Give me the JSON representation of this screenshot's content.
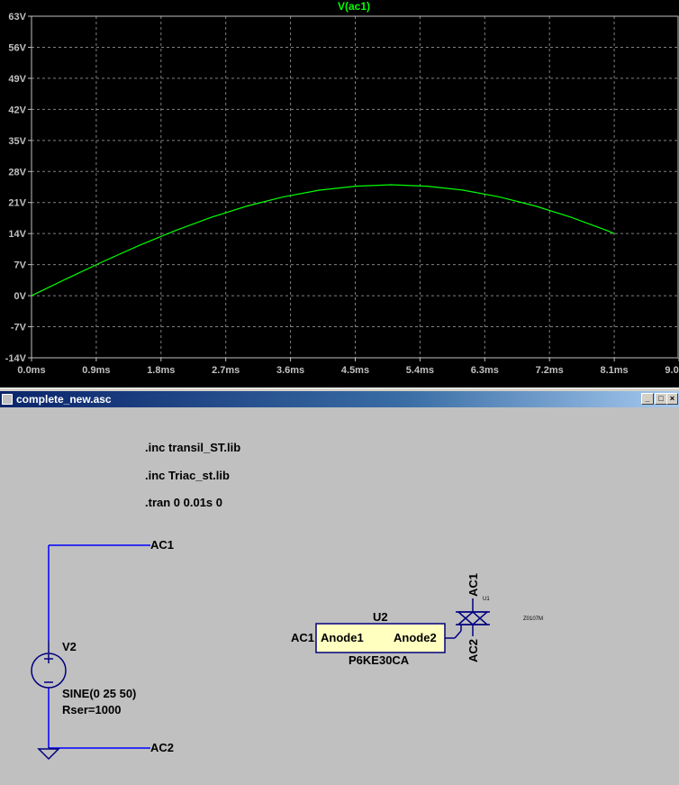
{
  "plot": {
    "trace_label": "V(ac1)",
    "y_ticks": [
      "63V",
      "56V",
      "49V",
      "42V",
      "35V",
      "28V",
      "21V",
      "14V",
      "7V",
      "0V",
      "-7V",
      "-14V"
    ],
    "x_ticks": [
      "0.0ms",
      "0.9ms",
      "1.8ms",
      "2.7ms",
      "3.6ms",
      "4.5ms",
      "5.4ms",
      "6.3ms",
      "7.2ms",
      "8.1ms",
      "9.0ms"
    ],
    "colors": {
      "background": "#000000",
      "trace": "#00ff00",
      "grid": "#808080",
      "text": "#c0c0c0"
    }
  },
  "chart_data": {
    "type": "line",
    "series": [
      {
        "name": "V(ac1)",
        "x_ms": [
          0,
          0.5,
          1,
          1.5,
          2,
          2.5,
          3,
          3.5,
          4,
          4.5,
          5,
          5.5,
          6,
          6.5,
          7,
          7.5,
          8,
          8.1
        ],
        "y_v": [
          0,
          3.91,
          7.73,
          11.35,
          14.69,
          17.68,
          20.23,
          22.29,
          23.78,
          24.69,
          25.0,
          24.69,
          23.78,
          22.29,
          20.23,
          17.68,
          14.69,
          14.0
        ]
      }
    ],
    "xlim_ms": [
      0,
      9.0
    ],
    "ylim_v": [
      -14,
      63
    ],
    "grid": true
  },
  "window": {
    "title": "complete_new.asc",
    "min_glyph": "_",
    "max_glyph": "□",
    "close_glyph": "×"
  },
  "schematic": {
    "directives": [
      ".inc transil_ST.lib",
      ".inc Triac_st.lib",
      ".tran 0 0.01s 0"
    ],
    "v2": {
      "name": "V2",
      "value": "SINE(0 25 50)",
      "rser": "Rser=1000"
    },
    "net_ac1": "AC1",
    "net_ac2": "AC2",
    "u2": {
      "name": "U2",
      "pin1": "Anode1",
      "pin2": "Anode2",
      "model": "P6KE30CA",
      "left_net": "AC1"
    },
    "u1": {
      "label": "U1",
      "pin_top": "AC1",
      "pin_bottom": "AC2",
      "model": "Z0107M"
    },
    "colors": {
      "wire": "#0000ff",
      "symbol": "#000080",
      "component_fill": "#ffffc0"
    }
  }
}
